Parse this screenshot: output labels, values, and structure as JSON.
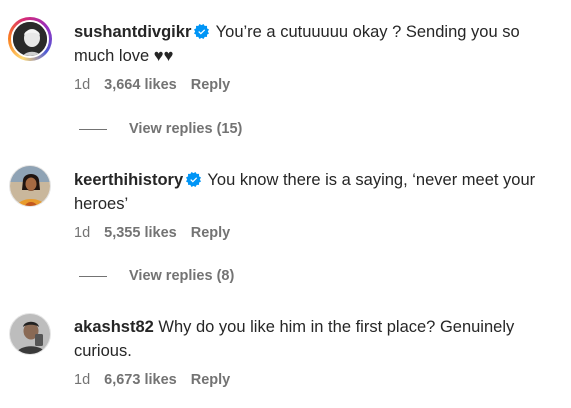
{
  "comments": [
    {
      "username": "sushantdivgikr",
      "verified": true,
      "text": "You’re a cutuuuuu okay ? Sending you so much love ❤️❤️",
      "text_display": "You’re a cutuuuuu okay ? Sending you so much love ♥♥",
      "time": "1d",
      "likes": "3,664 likes",
      "reply_label": "Reply",
      "view_replies": "View replies",
      "replies_count": "(15)"
    },
    {
      "username": "keerthihistory",
      "verified": true,
      "text": "You know there is a saying, ‘never meet your heroes’",
      "time": "1d",
      "likes": "5,355 likes",
      "reply_label": "Reply",
      "view_replies": "View replies",
      "replies_count": "(8)"
    },
    {
      "username": "akashst82",
      "verified": false,
      "text": "Why do you like him in the first place? Genuinely curious.",
      "time": "1d",
      "likes": "6,673 likes",
      "reply_label": "Reply"
    }
  ],
  "colors": {
    "verified": "#0095f6",
    "meta": "#737373",
    "text": "#262626"
  },
  "icons": {
    "verified": "verified-badge-icon"
  }
}
